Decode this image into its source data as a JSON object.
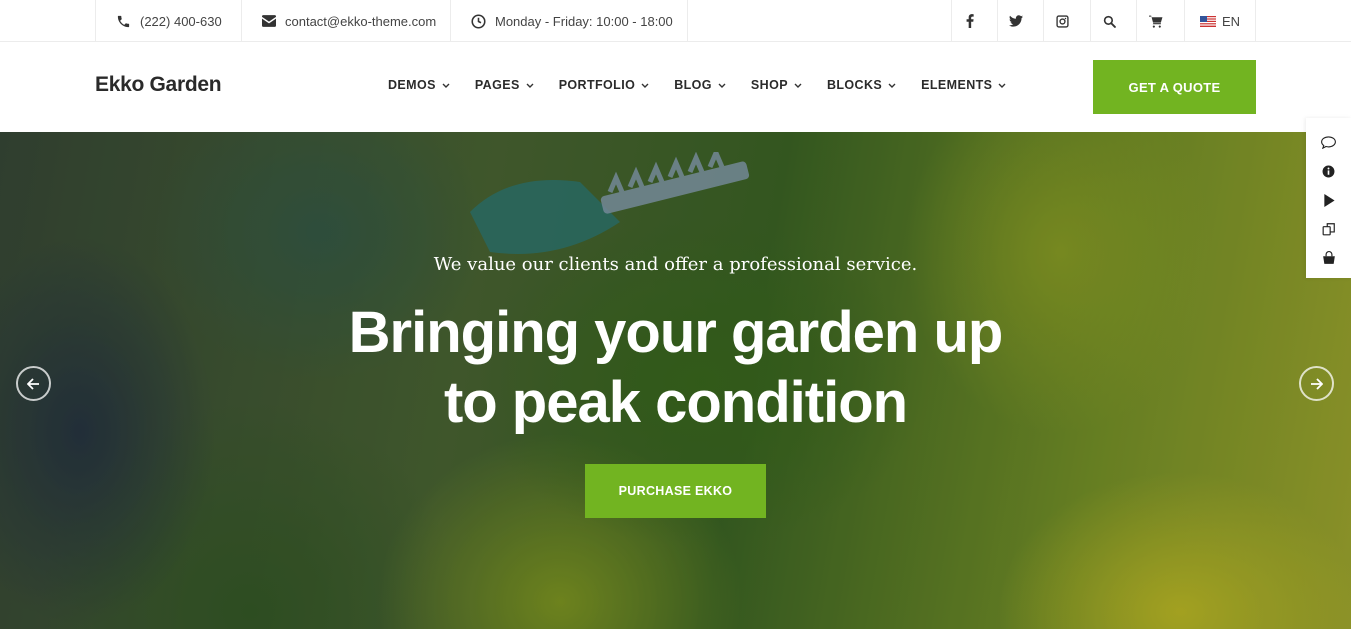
{
  "topbar": {
    "phone": "(222) 400-630",
    "email": "contact@ekko-theme.com",
    "hours": "Monday - Friday: 10:00 - 18:00",
    "language": "EN"
  },
  "header": {
    "logo": "Ekko Garden",
    "nav": [
      "DEMOS",
      "PAGES",
      "PORTFOLIO",
      "BLOG",
      "SHOP",
      "BLOCKS",
      "ELEMENTS"
    ],
    "cta": "GET A QUOTE"
  },
  "hero": {
    "subtitle": "We value our clients and offer a professional service.",
    "title_line1": "Bringing your garden up",
    "title_line2": "to peak condition",
    "button": "PURCHASE EKKO"
  },
  "icons": {
    "topbar": [
      "phone-icon",
      "envelope-icon",
      "clock-icon",
      "facebook-icon",
      "twitter-icon",
      "instagram-icon",
      "search-icon",
      "cart-icon",
      "us-flag-icon"
    ],
    "side": [
      "comment-icon",
      "info-icon",
      "play-icon",
      "copy-icon",
      "bag-icon"
    ],
    "slider": [
      "arrow-left-icon",
      "arrow-right-icon"
    ]
  },
  "colors": {
    "accent": "#72b421",
    "text": "#2b2b2b",
    "white": "#ffffff"
  }
}
